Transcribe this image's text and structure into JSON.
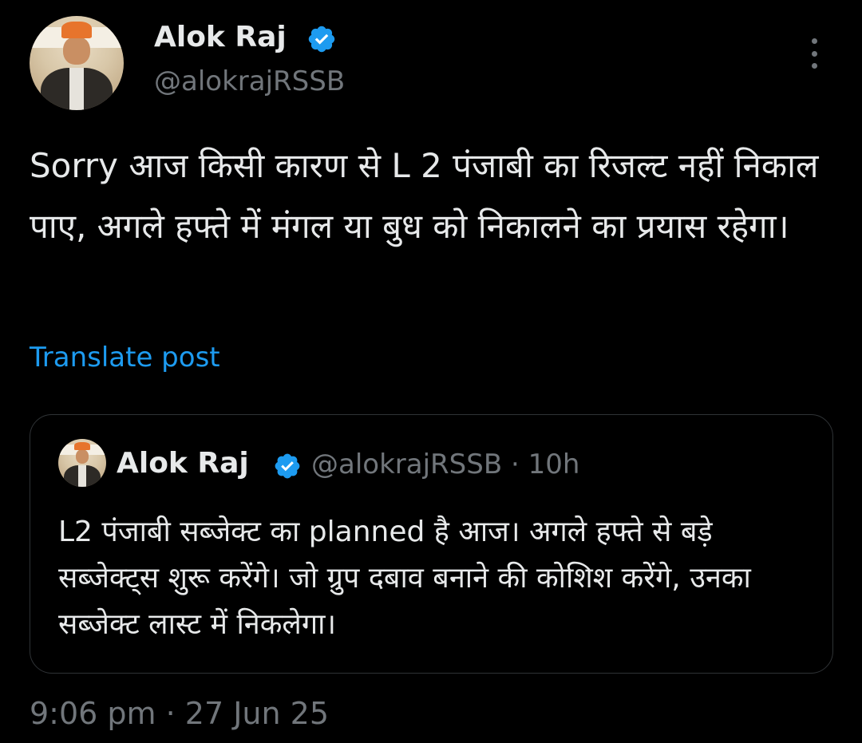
{
  "post": {
    "author_name": "Alok Raj",
    "author_handle": "@alokrajRSSB",
    "text": "Sorry आज किसी कारण से L 2 पंजाबी का रिजल्ट नहीं निकाल पाए, अगले हफ्ते में मंगल या बुध को निकालने का प्रयास रहेगा।",
    "translate_label": "Translate post",
    "timestamp": "9:06 pm · 27 Jun 25"
  },
  "quote": {
    "author_name": "Alok Raj",
    "meta": "@alokrajRSSB · 10h",
    "text": "L2 पंजाबी सब्जेक्ट का planned है आज। अगले हफ्ते से बड़े सब्जेक्ट्स शुरू करेंगे। जो ग्रुप दबाव बनाने की कोशिश करेंगे, उनका सब्जेक्ट लास्ट में निकलेगा।"
  },
  "icons": {
    "verified": "verified-badge-icon",
    "more": "more-options-icon"
  },
  "colors": {
    "background": "#000000",
    "text": "#e7e9ea",
    "secondary": "#71767b",
    "link": "#1d9bf0",
    "border": "#2f3336"
  }
}
